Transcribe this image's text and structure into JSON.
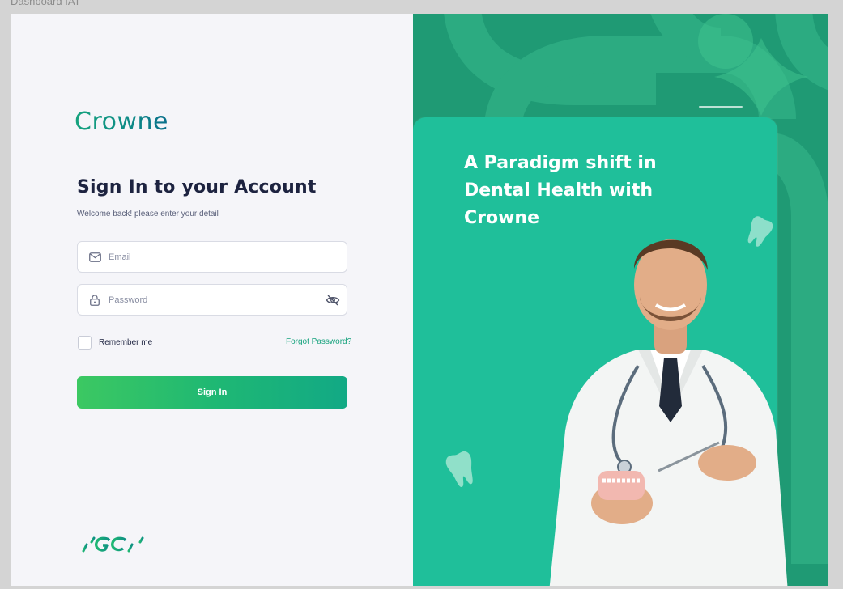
{
  "frame_label": "Dashboard IAT",
  "brand": {
    "name": "Crowne",
    "colors": {
      "primary": "#17a37e",
      "secondary": "#0a6f8c",
      "panel": "#1f9a74",
      "card": "#1fbf9a"
    }
  },
  "login": {
    "title": "Sign In to your Account",
    "subtitle": "Welcome back! please enter your detail",
    "email_placeholder": "Email",
    "password_placeholder": "Password",
    "remember_label": "Remember me",
    "forgot_label": "Forgot Password?",
    "signin_label": "Sign In"
  },
  "icons": {
    "email": "mail-icon",
    "password": "lock-icon",
    "toggle": "eye-off-icon",
    "tooth": "tooth-icon",
    "partner_logo": "gc-logo"
  },
  "hero": {
    "headline": "A Paradigm shift in Dental Health with Crowne"
  }
}
